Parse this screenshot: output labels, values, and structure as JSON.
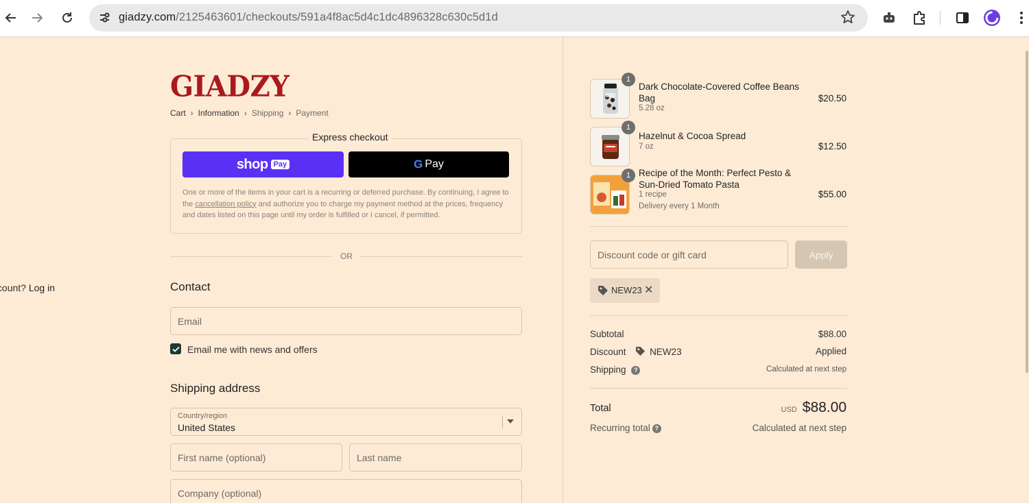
{
  "browser": {
    "url_domain": "giadzy.com",
    "url_path": "/2125463601/checkouts/591a4f8ac5d4c1dc4896328c630c5d1d",
    "icons": [
      "back-arrow-icon",
      "forward-arrow-icon",
      "reload-icon",
      "site-info-icon",
      "bookmark-star-icon",
      "extension-robot-icon",
      "extensions-puzzle-icon",
      "side-panel-icon",
      "profile-avatar-icon",
      "menu-kebab-icon"
    ]
  },
  "brand": {
    "logo_text": "GIADZY",
    "logo_color": "#a91a1f"
  },
  "breadcrumb": {
    "cart": "Cart",
    "information": "Information",
    "shipping": "Shipping",
    "payment": "Payment"
  },
  "express": {
    "title": "Express checkout",
    "shoppay_word": "shop",
    "shoppay_badge": "Pay",
    "gpay_g": "G",
    "gpay_word": "Pay",
    "disclaimer_before": "One or more of the items in your cart is a recurring or deferred purchase. By continuing, I agree to the ",
    "disclaimer_link": "cancellation policy",
    "disclaimer_after": " and authorize you to charge my payment method at the prices, frequency and dates listed on this page until my order is fulfilled or I cancel, if permitted.",
    "or_text": "OR"
  },
  "contact": {
    "title": "Contact",
    "account_prompt": "Have an account?",
    "login_link": "Log in",
    "email_placeholder": "Email",
    "newsletter_label": "Email me with news and offers",
    "newsletter_checked": true
  },
  "shipping": {
    "title": "Shipping address",
    "country_label": "Country/region",
    "country_value": "United States",
    "first_name_placeholder": "First name (optional)",
    "last_name_placeholder": "Last name",
    "company_placeholder": "Company (optional)"
  },
  "cart": {
    "items": [
      {
        "qty": "1",
        "name": "Dark Chocolate-Covered Coffee Beans Bag",
        "variant": "5.28 oz",
        "extra": "",
        "price": "$20.50"
      },
      {
        "qty": "1",
        "name": "Hazelnut & Cocoa Spread",
        "variant": "7 oz",
        "extra": "",
        "price": "$12.50"
      },
      {
        "qty": "1",
        "name": "Recipe of the Month: Perfect Pesto & Sun-Dried Tomato Pasta",
        "variant": "1 recipe",
        "extra": "Delivery every 1 Month",
        "price": "$55.00"
      }
    ]
  },
  "discount": {
    "placeholder": "Discount code or gift card",
    "apply_label": "Apply",
    "applied_code": "NEW23",
    "remove_symbol": "✕"
  },
  "summary": {
    "subtotal_label": "Subtotal",
    "subtotal_value": "$88.00",
    "discount_label": "Discount",
    "discount_code": "NEW23",
    "discount_value": "Applied",
    "shipping_label": "Shipping",
    "shipping_value": "Calculated at next step",
    "help_symbol": "?",
    "total_label": "Total",
    "currency": "USD",
    "total_value": "$88.00",
    "recurring_label": "Recurring total",
    "recurring_value": "Calculated at next step"
  },
  "colors": {
    "page_bg": "#fdebd6",
    "shoppay": "#5a31f4",
    "gpay": "#000000",
    "checkbox": "#1e3a33",
    "apply_disabled": "#d5c5b3"
  }
}
